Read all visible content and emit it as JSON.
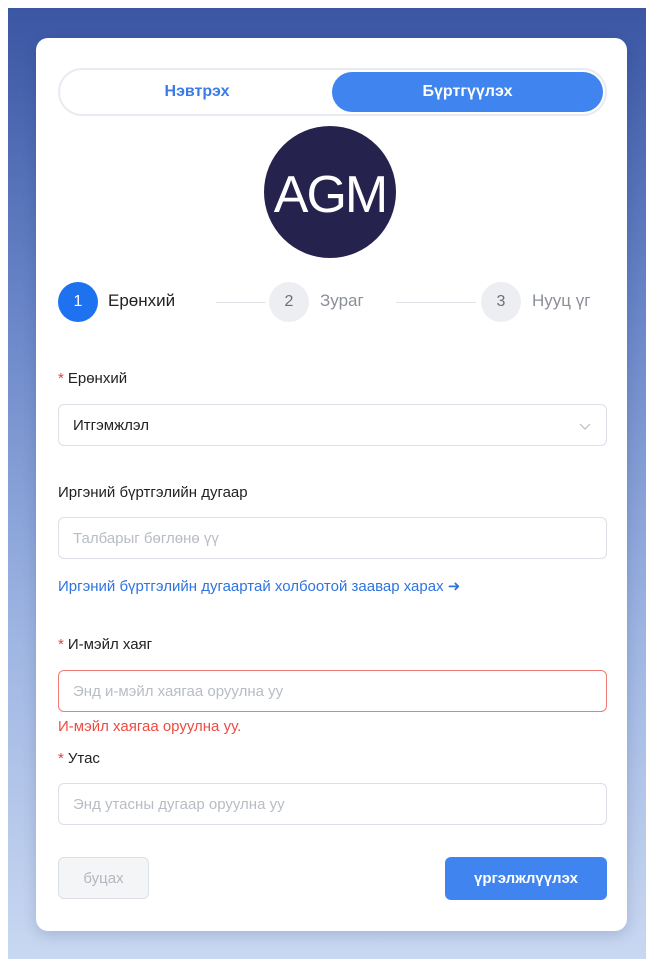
{
  "tabs": {
    "login_label": "Нэвтрэх",
    "register_label": "Бүртгүүлэх",
    "active": "register"
  },
  "logo": {
    "text": "AGM"
  },
  "steps": [
    {
      "number": "1",
      "label": "Ерөнхий",
      "active": true
    },
    {
      "number": "2",
      "label": "Зураг",
      "active": false
    },
    {
      "number": "3",
      "label": "Нууц үг",
      "active": false
    }
  ],
  "form": {
    "general": {
      "label": "Ерөнхий",
      "required": "*",
      "selected_value": "Итгэмжлэл"
    },
    "registration_number": {
      "label": "Иргэний бүртгэлийн дугаар",
      "placeholder": "Талбарыг бөглөнө үү",
      "help_link": "Иргэний бүртгэлийн дугаартай холбоотой заавар харах ➜"
    },
    "email": {
      "label": "И-мэйл хаяг",
      "required": "*",
      "placeholder": "Энд и-мэйл хаягаа  оруулна уу",
      "error": "И-мэйл хаягаа оруулна уу."
    },
    "phone": {
      "label": "Утас",
      "required": "*",
      "placeholder": "Энд утасны дугаар оруулна уу"
    }
  },
  "buttons": {
    "back_label": "буцах",
    "next_label": "үргэлжлүүлэх"
  },
  "colors": {
    "accent": "#3f84ef",
    "step_active": "#1e72f0",
    "error": "#ef4b43",
    "logo_bg": "#25234e"
  }
}
